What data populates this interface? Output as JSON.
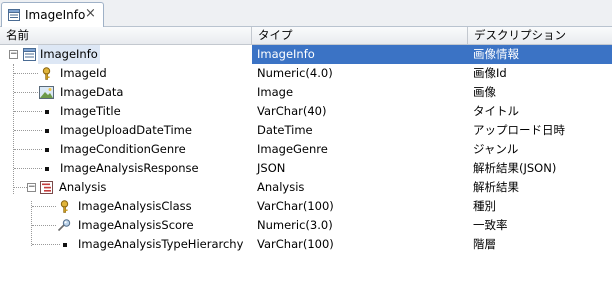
{
  "tab": {
    "label": "ImageInfo",
    "close_glyph": "×"
  },
  "columns": [
    "名前",
    "タイプ",
    "デスクリプション"
  ],
  "rows": [
    {
      "name": "ImageInfo",
      "type": "ImageInfo",
      "desc": "画像情報"
    },
    {
      "name": "ImageId",
      "type": "Numeric(4.0)",
      "desc": "画像Id"
    },
    {
      "name": "ImageData",
      "type": "Image",
      "desc": "画像"
    },
    {
      "name": "ImageTitle",
      "type": "VarChar(40)",
      "desc": "タイトル"
    },
    {
      "name": "ImageUploadDateTime",
      "type": "DateTime",
      "desc": "アップロード日時"
    },
    {
      "name": "ImageConditionGenre",
      "type": "ImageGenre",
      "desc": "ジャンル"
    },
    {
      "name": "ImageAnalysisResponse",
      "type": "JSON",
      "desc": "解析結果(JSON)"
    },
    {
      "name": "Analysis",
      "type": "Analysis",
      "desc": "解析結果"
    },
    {
      "name": "ImageAnalysisClass",
      "type": "VarChar(100)",
      "desc": "種別"
    },
    {
      "name": "ImageAnalysisScore",
      "type": "Numeric(3.0)",
      "desc": "一致率"
    },
    {
      "name": "ImageAnalysisTypeHierarchy",
      "type": "VarChar(100)",
      "desc": "階層"
    }
  ],
  "icons": {
    "root": "table-structure-icon",
    "key": "key-icon",
    "image": "image-icon",
    "level": "level-icon",
    "formula": "formula-icon",
    "bullet": "attribute-bullet-icon"
  },
  "colors": {
    "selection": "#3b73c5",
    "key_gold": "#c99a1c"
  }
}
